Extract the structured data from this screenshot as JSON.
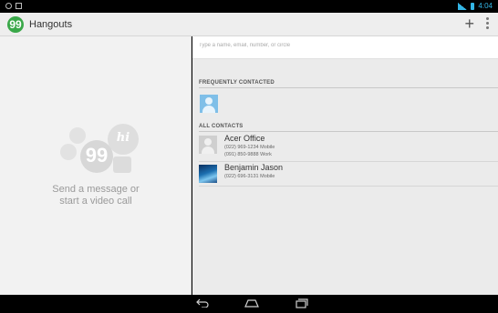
{
  "app": {
    "title": "Hangouts",
    "logo_glyph": "99"
  },
  "statusbar": {
    "time": "4:04",
    "accent": "#33b5e5"
  },
  "toolbar": {
    "add_label": "+"
  },
  "empty_state": {
    "line1": "Send a message or",
    "line2": "start a video call",
    "hi_text": "hi",
    "quote_text": "99"
  },
  "search": {
    "placeholder": "Type a name, email, number, or circle",
    "value": ""
  },
  "sections": {
    "frequent_header": "FREQUENTLY CONTACTED",
    "all_header": "ALL CONTACTS"
  },
  "contacts": [
    {
      "name": "Acer Office",
      "phones": [
        "(022) 969-1234 Mobile",
        "(091) 850-9888 Work"
      ],
      "avatar": "generic"
    },
    {
      "name": "Benjamin Jason",
      "phones": [
        "(022) 696-3131 Mobile"
      ],
      "avatar": "photo"
    }
  ],
  "colors": {
    "brand": "#3aa849",
    "actionbar_bg": "#eeeeee",
    "pane_bg": "#f2f2f2"
  }
}
